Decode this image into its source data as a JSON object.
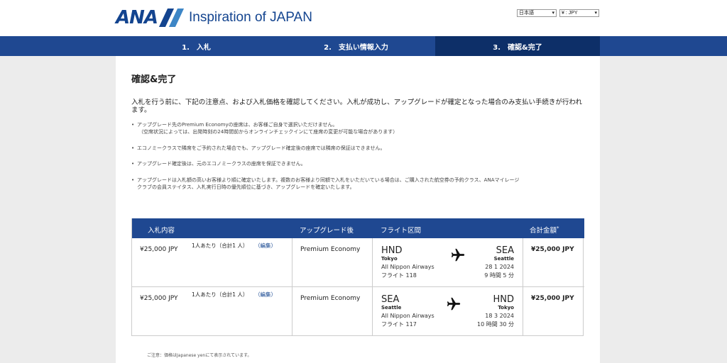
{
  "header": {
    "logo_text": "ANA",
    "tagline": "Inspiration of JAPAN",
    "language_select": "日本語",
    "currency_select": "¥ : JPY"
  },
  "steps": [
    {
      "label": "1.　入札"
    },
    {
      "label": "2.　支払い情報入力"
    },
    {
      "label": "3.　確認&完了"
    }
  ],
  "page": {
    "title": "確認&完了",
    "intro": "入札を行う前に、下記の注意点、および入札価格を確認してください。入札が成功し、アップグレードが確定となった場合のみ支払い手続きが行われます。",
    "notes": [
      {
        "line1": "アップグレード先のPremium Economyの座席は、お客様ご自身で選択いただけません。",
        "line2": "（空席状況によっては、出発時刻の24時間前からオンラインチェックインにて座席の変更が可能な場合があります）"
      },
      {
        "line1": "エコノミークラスで隣席をご予約された場合でも、アップグレード確定後の座席では隣席の保証はできません。",
        "line2": ""
      },
      {
        "line1": "アップグレード確定後は、元のエコノミークラスの座席を保証できません。",
        "line2": ""
      },
      {
        "line1": "アップグレードは入札額の高いお客様より順に確定いたします。複数のお客様より同額で入札をいただいている場合は、ご購入された航空券の予約クラス、ANAマイレージ",
        "line2": "クラブの会員ステイタス、入札実行日時の優先順位に基づき、アップグレードを確定いたします。"
      }
    ],
    "footnote": "ご注意：価格はJapanese yenにて表示されています。"
  },
  "table": {
    "headers": {
      "bid": "入札内容",
      "upgrade": "アップグレード後",
      "flight": "フライト区間",
      "total": "合計金額",
      "total_mark": "*"
    },
    "rows": [
      {
        "price": "¥25,000 JPY",
        "per_person": "1人あたり（合計1 人）",
        "edit": "（編集）",
        "upgrade": "Premium Economy",
        "from_code": "HND",
        "from_city": "Tokyo",
        "to_code": "SEA",
        "to_city": "Seattle",
        "airline": "All Nippon Airways",
        "flight": "フライト 118",
        "date": "28 1 2024",
        "duration": "9 時間 5 分",
        "total": "¥25,000 JPY"
      },
      {
        "price": "¥25,000 JPY",
        "per_person": "1人あたり（合計1 人）",
        "edit": "（編集）",
        "upgrade": "Premium Economy",
        "from_code": "SEA",
        "from_city": "Seattle",
        "to_code": "HND",
        "to_city": "Tokyo",
        "airline": "All Nippon Airways",
        "flight": "フライト 117",
        "date": "18 3 2024",
        "duration": "10 時間 30 分",
        "total": "¥25,000 JPY"
      }
    ]
  },
  "colors": {
    "brand_navy": "#13448f",
    "step_bar": "#1f4891",
    "step_active": "#0d2f68",
    "brand_light": "#3d86c6"
  }
}
